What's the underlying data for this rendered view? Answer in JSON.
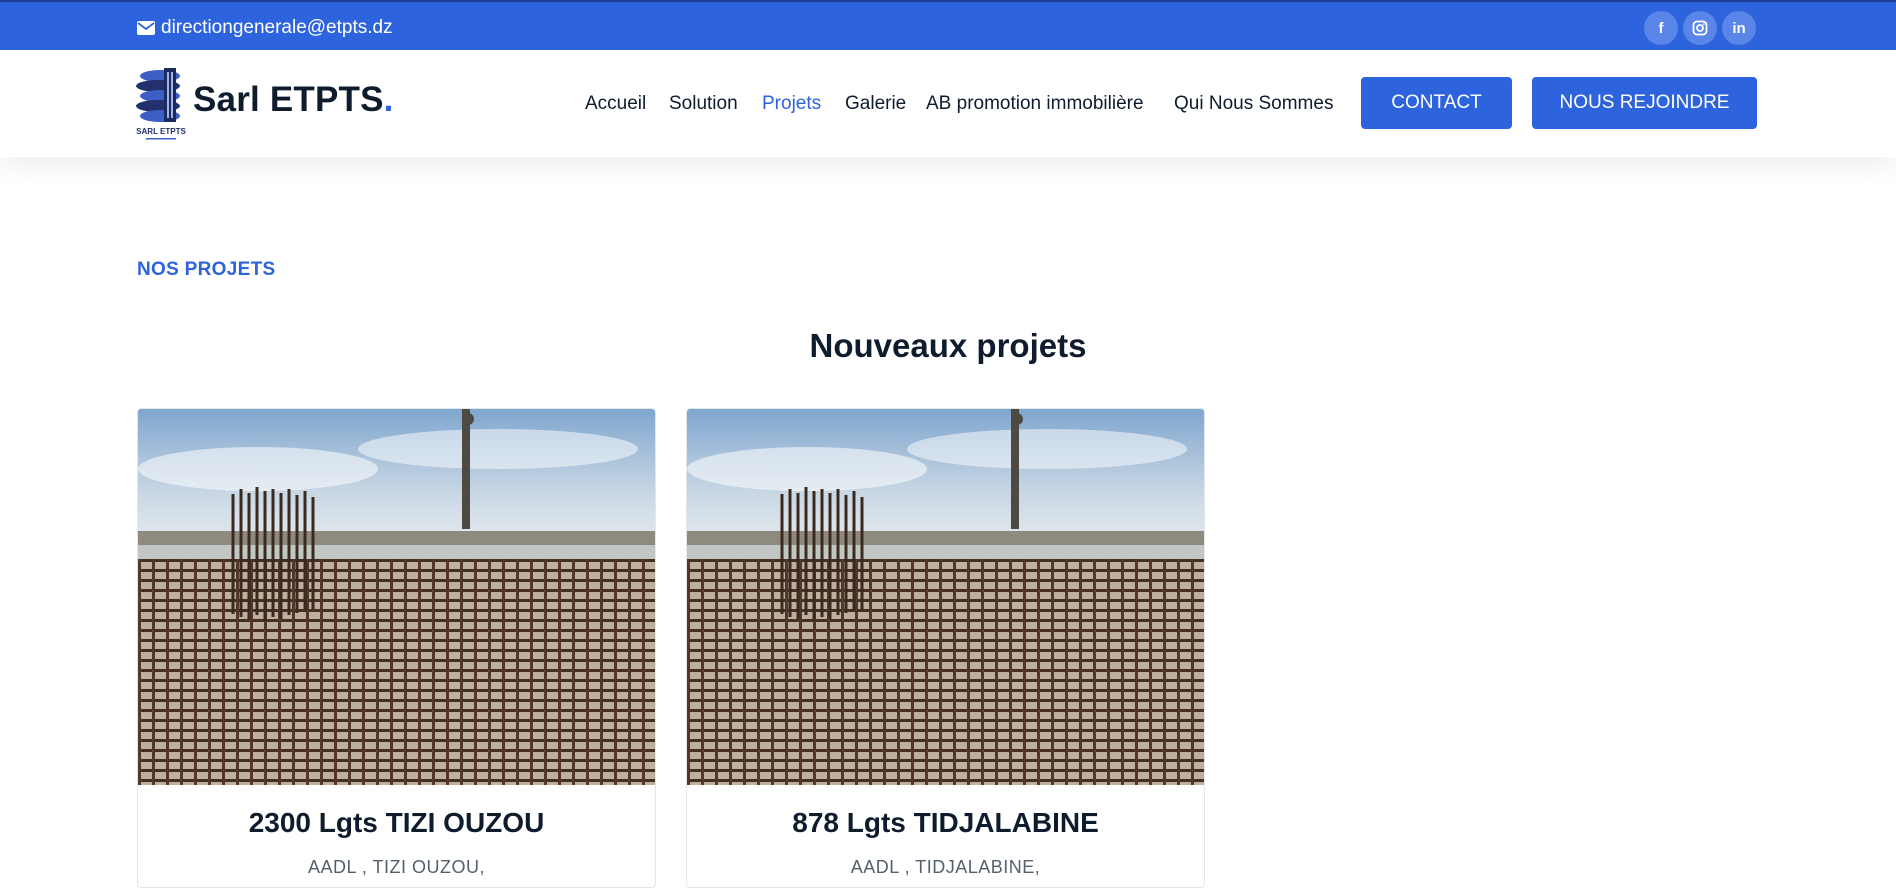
{
  "topbar": {
    "email": "directiongenerale@etpts.dz",
    "email_icon": "mail-icon",
    "social": [
      {
        "icon": "facebook-icon",
        "glyph": "f"
      },
      {
        "icon": "instagram-icon",
        "glyph": "◎"
      },
      {
        "icon": "linkedin-icon",
        "glyph": "in"
      }
    ]
  },
  "header": {
    "logo_caption": "SARL ETPTS",
    "brand_name": "Sarl ETPTS",
    "brand_dot": ".",
    "nav": [
      {
        "label": "Accueil",
        "active": false
      },
      {
        "label": "Solution",
        "active": false
      },
      {
        "label": "Projets",
        "active": true
      },
      {
        "label": "Galerie",
        "active": false
      },
      {
        "label": "AB promotion immobilière",
        "active": false
      },
      {
        "label": "Qui Nous Sommes",
        "active": false
      }
    ],
    "contact_button": "CONTACT",
    "join_button": "NOUS REJOINDRE"
  },
  "main": {
    "section_label": "NOS PROJETS",
    "section_title": "Nouveaux projets",
    "projects": [
      {
        "title": "2300 Lgts TIZI OUZOU",
        "subtitle": "AADL , TIZI OUZOU,"
      },
      {
        "title": "878 Lgts TIDJALABINE",
        "subtitle": "AADL , TIDJALABINE,"
      }
    ]
  },
  "colors": {
    "brand_blue": "#2e63de",
    "dark_text": "#0f1c2e",
    "muted_text": "#55606e"
  }
}
